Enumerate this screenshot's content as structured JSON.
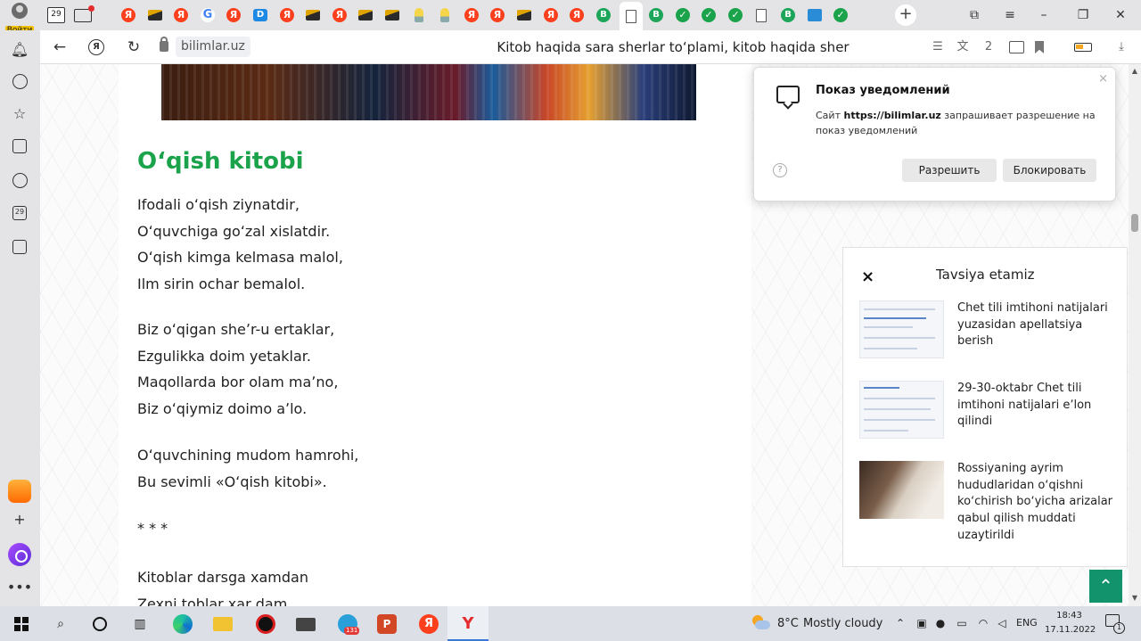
{
  "browser": {
    "login_label": "Войти",
    "home_tab_badge": "29",
    "address": {
      "domain": "bilimlar.uz",
      "page_title": "Kitob haqida sara sherlar toʻplami, kitob haqida sher"
    },
    "yandex_glyph": "Я",
    "toolbar_badge": "2",
    "tab_icons": [
      "yandex",
      "mountain",
      "yandex",
      "google",
      "yandex",
      "d-app",
      "yandex",
      "mountain",
      "yandex",
      "mountain",
      "mountain",
      "bulb",
      "bulb",
      "yandex",
      "yandex",
      "mountain",
      "yandex",
      "yandex",
      "b-site",
      "doc",
      "b-site",
      "check",
      "check",
      "check",
      "doc",
      "b-site",
      "screen",
      "check"
    ],
    "sidebar_badge": "29",
    "accent_color": "#1aa34a"
  },
  "article": {
    "title": "Oʻqish kitobi",
    "stanzas": [
      [
        "Ifodali oʻqish ziynatdir,",
        "Oʻquvchiga goʻzal xislatdir.",
        "Oʻqish kimga kelmasa malol,",
        "Ilm sirin ochar bemalol."
      ],
      [
        "Biz oʻqigan sheʼr-u ertaklar,",
        "Ezgulikka doim yetaklar.",
        "Maqollarda bor olam maʼno,",
        "Biz oʻqiymiz doimo aʼlo."
      ],
      [
        "Oʻquvchining mudom hamrohi,",
        "Bu sevimli «Oʻqish kitobi»."
      ],
      [
        "* * *"
      ],
      [
        "Kitoblar darsga xamdan",
        "Zexni toblar xar dam"
      ]
    ]
  },
  "recommendations": {
    "title": "Tavsiya etamiz",
    "close": "×",
    "items": [
      {
        "text": "Chet tili imtihoni natijalari yuzasidan apellatsiya berish"
      },
      {
        "text": "29-30-oktabr Chet tili imtihoni natijalari eʼlon qilindi"
      },
      {
        "text": "Rossiyaning ayrim hududlaridan oʻqishni koʻchirish boʻyicha arizalar qabul qilish muddati uzaytirildi"
      }
    ]
  },
  "notification": {
    "title": "Показ уведомлений",
    "text_prefix": "Сайт",
    "site": "https://bilimlar.uz",
    "text_suffix": "запрашивает разрешение на показ уведомлений",
    "allow": "Разрешить",
    "block": "Блокировать",
    "help": "?",
    "close": "×"
  },
  "taskbar": {
    "weather_temp": "8°C",
    "weather_text": "Mostly cloudy",
    "language": "ENG",
    "time": "18:43",
    "date": "17.11.2022",
    "telegram_badge": "131",
    "notification_count": "1"
  }
}
